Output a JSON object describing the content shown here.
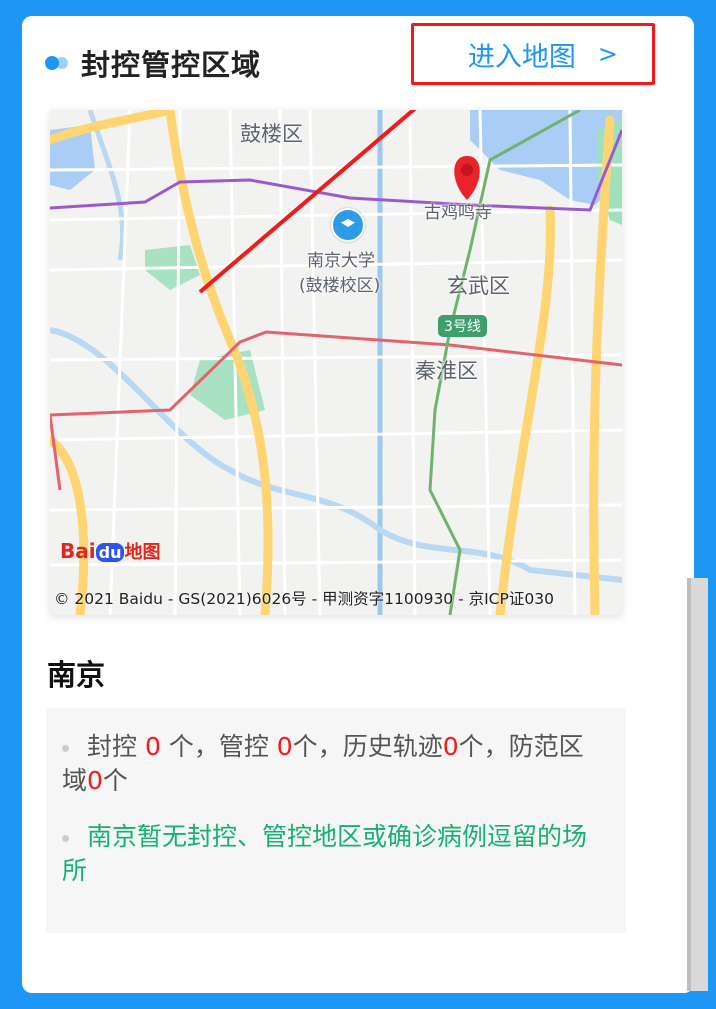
{
  "header": {
    "title": "封控管控区域",
    "enter_map_label": "进入地图",
    "enter_map_chevron": ">"
  },
  "map": {
    "labels": {
      "gulou_district": "鼓楼区",
      "gujiming_temple": "古鸡鸣寺",
      "nju_line1": "南京大学",
      "nju_line2": "(鼓楼校区)",
      "xuanwu_district": "玄武区",
      "metro_line": "3号线",
      "qinhuai_district": "秦淮区"
    },
    "logo": {
      "part1": "Bai",
      "part2": "du",
      "part3": "地图"
    },
    "copyright": "© 2021 Baidu - GS(2021)6026号 - 甲测资字1100930 - 京ICP证030"
  },
  "city": "南京",
  "stats": {
    "prefix": "封控",
    "sealed_count": "0",
    "controlled_label": " 个，管控 ",
    "controlled_count": "0",
    "history_label": "个，历史轨迹",
    "history_count": "0",
    "prevent_label": "个，防范区域",
    "prevent_count": "0",
    "suffix": "个"
  },
  "notice": "南京暂无封控、管控地区或确诊病例逗留的场所",
  "colors": {
    "background": "#1e96f5",
    "accent": "#1e96f5",
    "highlight_red": "#f21a1a",
    "notice_green": "#16b172"
  }
}
